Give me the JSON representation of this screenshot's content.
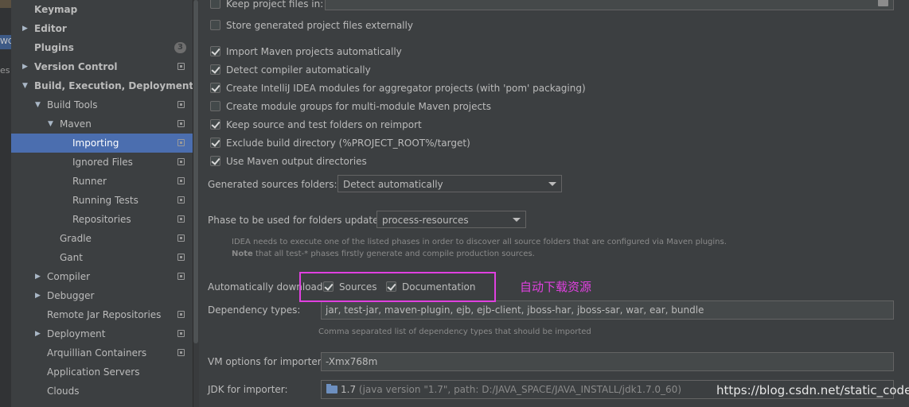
{
  "sidebar": {
    "items": [
      {
        "label": "Keymap",
        "indent": 0,
        "arrow": "",
        "bold": true,
        "selected": false,
        "badge": "",
        "proj_icon": false
      },
      {
        "label": "Editor",
        "indent": 0,
        "arrow": "right",
        "bold": true,
        "selected": false,
        "badge": "",
        "proj_icon": false
      },
      {
        "label": "Plugins",
        "indent": 0,
        "arrow": "",
        "bold": true,
        "selected": false,
        "badge": "3",
        "proj_icon": false
      },
      {
        "label": "Version Control",
        "indent": 0,
        "arrow": "right",
        "bold": true,
        "selected": false,
        "badge": "",
        "proj_icon": true
      },
      {
        "label": "Build, Execution, Deployment",
        "indent": 0,
        "arrow": "down",
        "bold": true,
        "selected": false,
        "badge": "",
        "proj_icon": false
      },
      {
        "label": "Build Tools",
        "indent": 1,
        "arrow": "down",
        "bold": false,
        "selected": false,
        "badge": "",
        "proj_icon": true
      },
      {
        "label": "Maven",
        "indent": 2,
        "arrow": "down",
        "bold": false,
        "selected": false,
        "badge": "",
        "proj_icon": true
      },
      {
        "label": "Importing",
        "indent": 3,
        "arrow": "",
        "bold": false,
        "selected": true,
        "badge": "",
        "proj_icon": true
      },
      {
        "label": "Ignored Files",
        "indent": 3,
        "arrow": "",
        "bold": false,
        "selected": false,
        "badge": "",
        "proj_icon": true
      },
      {
        "label": "Runner",
        "indent": 3,
        "arrow": "",
        "bold": false,
        "selected": false,
        "badge": "",
        "proj_icon": true
      },
      {
        "label": "Running Tests",
        "indent": 3,
        "arrow": "",
        "bold": false,
        "selected": false,
        "badge": "",
        "proj_icon": true
      },
      {
        "label": "Repositories",
        "indent": 3,
        "arrow": "",
        "bold": false,
        "selected": false,
        "badge": "",
        "proj_icon": true
      },
      {
        "label": "Gradle",
        "indent": 2,
        "arrow": "",
        "bold": false,
        "selected": false,
        "badge": "",
        "proj_icon": true
      },
      {
        "label": "Gant",
        "indent": 2,
        "arrow": "",
        "bold": false,
        "selected": false,
        "badge": "",
        "proj_icon": true
      },
      {
        "label": "Compiler",
        "indent": 1,
        "arrow": "right",
        "bold": false,
        "selected": false,
        "badge": "",
        "proj_icon": true
      },
      {
        "label": "Debugger",
        "indent": 1,
        "arrow": "right",
        "bold": false,
        "selected": false,
        "badge": "",
        "proj_icon": false
      },
      {
        "label": "Remote Jar Repositories",
        "indent": 1,
        "arrow": "",
        "bold": false,
        "selected": false,
        "badge": "",
        "proj_icon": true
      },
      {
        "label": "Deployment",
        "indent": 1,
        "arrow": "right",
        "bold": false,
        "selected": false,
        "badge": "",
        "proj_icon": true
      },
      {
        "label": "Arquillian Containers",
        "indent": 1,
        "arrow": "",
        "bold": false,
        "selected": false,
        "badge": "",
        "proj_icon": true
      },
      {
        "label": "Application Servers",
        "indent": 1,
        "arrow": "",
        "bold": false,
        "selected": false,
        "badge": "",
        "proj_icon": false
      },
      {
        "label": "Clouds",
        "indent": 1,
        "arrow": "",
        "bold": false,
        "selected": false,
        "badge": "",
        "proj_icon": false
      }
    ]
  },
  "edge": {
    "fragment_1": "WO",
    "fragment_2": "es"
  },
  "main": {
    "keep_project_files": {
      "label": "Keep project files in:",
      "checked": false
    },
    "store_externally": {
      "label": "Store generated project files externally",
      "checked": false
    },
    "checkboxes": [
      {
        "label": "Import Maven projects automatically",
        "checked": true
      },
      {
        "label": "Detect compiler automatically",
        "checked": true
      },
      {
        "label": "Create IntelliJ IDEA modules for aggregator projects (with 'pom' packaging)",
        "checked": true
      },
      {
        "label": "Create module groups for multi-module Maven projects",
        "checked": false
      },
      {
        "label": "Keep source and test folders on reimport",
        "checked": true
      },
      {
        "label": "Exclude build directory (%PROJECT_ROOT%/target)",
        "checked": true
      },
      {
        "label": "Use Maven output directories",
        "checked": true
      }
    ],
    "generated_sources": {
      "label": "Generated sources folders:",
      "value": "Detect automatically"
    },
    "phase": {
      "label": "Phase to be used for folders update:",
      "value": "process-resources"
    },
    "phase_hint_line1": "IDEA needs to execute one of the listed phases in order to discover all source folders that are configured via Maven plugins.",
    "phase_hint_note": "Note",
    "phase_hint_line2": " that all test-* phases firstly generate and compile production sources.",
    "auto_download": {
      "label": "Automatically download:",
      "sources": {
        "label": "Sources",
        "checked": true
      },
      "documentation": {
        "label": "Documentation",
        "checked": true
      }
    },
    "annotation": "自动下载资源",
    "annotation_color": "#e040e0",
    "dependency_types": {
      "label": "Dependency types:",
      "value": "jar, test-jar, maven-plugin, ejb, ejb-client, jboss-har, jboss-sar, war, ear, bundle",
      "hint": "Comma separated list of dependency types that should be imported"
    },
    "vm_options": {
      "label": "VM options for importer:",
      "value": "-Xmx768m"
    },
    "jdk": {
      "label": "JDK for importer:",
      "version": "1.7",
      "detail": " (java version \"1.7\", path: D:/JAVA_SPACE/JAVA_INSTALL/jdk1.7.0_60)"
    },
    "watermark": "https://blog.csdn.net/static_coder"
  },
  "colors": {
    "background": "#3c3f41",
    "selection": "#4b6eaf",
    "text": "#bbbbbb"
  }
}
